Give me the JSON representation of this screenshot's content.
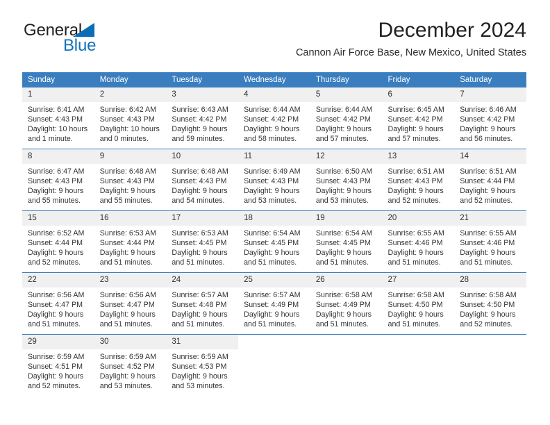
{
  "brand": {
    "name_part1": "General",
    "name_part2": "Blue",
    "accent_color": "#1172b8"
  },
  "header": {
    "title": "December 2024",
    "location": "Cannon Air Force Base, New Mexico, United States"
  },
  "theme": {
    "header_row_bg": "#3a7ebf",
    "daynum_bg": "#f0f0f0",
    "grid_line": "#3a7ebf"
  },
  "calendar": {
    "weekday_headers": [
      "Sunday",
      "Monday",
      "Tuesday",
      "Wednesday",
      "Thursday",
      "Friday",
      "Saturday"
    ],
    "weeks": [
      [
        {
          "day": "1",
          "sunrise": "Sunrise: 6:41 AM",
          "sunset": "Sunset: 4:43 PM",
          "daylight1": "Daylight: 10 hours",
          "daylight2": "and 1 minute."
        },
        {
          "day": "2",
          "sunrise": "Sunrise: 6:42 AM",
          "sunset": "Sunset: 4:43 PM",
          "daylight1": "Daylight: 10 hours",
          "daylight2": "and 0 minutes."
        },
        {
          "day": "3",
          "sunrise": "Sunrise: 6:43 AM",
          "sunset": "Sunset: 4:42 PM",
          "daylight1": "Daylight: 9 hours",
          "daylight2": "and 59 minutes."
        },
        {
          "day": "4",
          "sunrise": "Sunrise: 6:44 AM",
          "sunset": "Sunset: 4:42 PM",
          "daylight1": "Daylight: 9 hours",
          "daylight2": "and 58 minutes."
        },
        {
          "day": "5",
          "sunrise": "Sunrise: 6:44 AM",
          "sunset": "Sunset: 4:42 PM",
          "daylight1": "Daylight: 9 hours",
          "daylight2": "and 57 minutes."
        },
        {
          "day": "6",
          "sunrise": "Sunrise: 6:45 AM",
          "sunset": "Sunset: 4:42 PM",
          "daylight1": "Daylight: 9 hours",
          "daylight2": "and 57 minutes."
        },
        {
          "day": "7",
          "sunrise": "Sunrise: 6:46 AM",
          "sunset": "Sunset: 4:42 PM",
          "daylight1": "Daylight: 9 hours",
          "daylight2": "and 56 minutes."
        }
      ],
      [
        {
          "day": "8",
          "sunrise": "Sunrise: 6:47 AM",
          "sunset": "Sunset: 4:43 PM",
          "daylight1": "Daylight: 9 hours",
          "daylight2": "and 55 minutes."
        },
        {
          "day": "9",
          "sunrise": "Sunrise: 6:48 AM",
          "sunset": "Sunset: 4:43 PM",
          "daylight1": "Daylight: 9 hours",
          "daylight2": "and 55 minutes."
        },
        {
          "day": "10",
          "sunrise": "Sunrise: 6:48 AM",
          "sunset": "Sunset: 4:43 PM",
          "daylight1": "Daylight: 9 hours",
          "daylight2": "and 54 minutes."
        },
        {
          "day": "11",
          "sunrise": "Sunrise: 6:49 AM",
          "sunset": "Sunset: 4:43 PM",
          "daylight1": "Daylight: 9 hours",
          "daylight2": "and 53 minutes."
        },
        {
          "day": "12",
          "sunrise": "Sunrise: 6:50 AM",
          "sunset": "Sunset: 4:43 PM",
          "daylight1": "Daylight: 9 hours",
          "daylight2": "and 53 minutes."
        },
        {
          "day": "13",
          "sunrise": "Sunrise: 6:51 AM",
          "sunset": "Sunset: 4:43 PM",
          "daylight1": "Daylight: 9 hours",
          "daylight2": "and 52 minutes."
        },
        {
          "day": "14",
          "sunrise": "Sunrise: 6:51 AM",
          "sunset": "Sunset: 4:44 PM",
          "daylight1": "Daylight: 9 hours",
          "daylight2": "and 52 minutes."
        }
      ],
      [
        {
          "day": "15",
          "sunrise": "Sunrise: 6:52 AM",
          "sunset": "Sunset: 4:44 PM",
          "daylight1": "Daylight: 9 hours",
          "daylight2": "and 52 minutes."
        },
        {
          "day": "16",
          "sunrise": "Sunrise: 6:53 AM",
          "sunset": "Sunset: 4:44 PM",
          "daylight1": "Daylight: 9 hours",
          "daylight2": "and 51 minutes."
        },
        {
          "day": "17",
          "sunrise": "Sunrise: 6:53 AM",
          "sunset": "Sunset: 4:45 PM",
          "daylight1": "Daylight: 9 hours",
          "daylight2": "and 51 minutes."
        },
        {
          "day": "18",
          "sunrise": "Sunrise: 6:54 AM",
          "sunset": "Sunset: 4:45 PM",
          "daylight1": "Daylight: 9 hours",
          "daylight2": "and 51 minutes."
        },
        {
          "day": "19",
          "sunrise": "Sunrise: 6:54 AM",
          "sunset": "Sunset: 4:45 PM",
          "daylight1": "Daylight: 9 hours",
          "daylight2": "and 51 minutes."
        },
        {
          "day": "20",
          "sunrise": "Sunrise: 6:55 AM",
          "sunset": "Sunset: 4:46 PM",
          "daylight1": "Daylight: 9 hours",
          "daylight2": "and 51 minutes."
        },
        {
          "day": "21",
          "sunrise": "Sunrise: 6:55 AM",
          "sunset": "Sunset: 4:46 PM",
          "daylight1": "Daylight: 9 hours",
          "daylight2": "and 51 minutes."
        }
      ],
      [
        {
          "day": "22",
          "sunrise": "Sunrise: 6:56 AM",
          "sunset": "Sunset: 4:47 PM",
          "daylight1": "Daylight: 9 hours",
          "daylight2": "and 51 minutes."
        },
        {
          "day": "23",
          "sunrise": "Sunrise: 6:56 AM",
          "sunset": "Sunset: 4:47 PM",
          "daylight1": "Daylight: 9 hours",
          "daylight2": "and 51 minutes."
        },
        {
          "day": "24",
          "sunrise": "Sunrise: 6:57 AM",
          "sunset": "Sunset: 4:48 PM",
          "daylight1": "Daylight: 9 hours",
          "daylight2": "and 51 minutes."
        },
        {
          "day": "25",
          "sunrise": "Sunrise: 6:57 AM",
          "sunset": "Sunset: 4:49 PM",
          "daylight1": "Daylight: 9 hours",
          "daylight2": "and 51 minutes."
        },
        {
          "day": "26",
          "sunrise": "Sunrise: 6:58 AM",
          "sunset": "Sunset: 4:49 PM",
          "daylight1": "Daylight: 9 hours",
          "daylight2": "and 51 minutes."
        },
        {
          "day": "27",
          "sunrise": "Sunrise: 6:58 AM",
          "sunset": "Sunset: 4:50 PM",
          "daylight1": "Daylight: 9 hours",
          "daylight2": "and 51 minutes."
        },
        {
          "day": "28",
          "sunrise": "Sunrise: 6:58 AM",
          "sunset": "Sunset: 4:50 PM",
          "daylight1": "Daylight: 9 hours",
          "daylight2": "and 52 minutes."
        }
      ],
      [
        {
          "day": "29",
          "sunrise": "Sunrise: 6:59 AM",
          "sunset": "Sunset: 4:51 PM",
          "daylight1": "Daylight: 9 hours",
          "daylight2": "and 52 minutes."
        },
        {
          "day": "30",
          "sunrise": "Sunrise: 6:59 AM",
          "sunset": "Sunset: 4:52 PM",
          "daylight1": "Daylight: 9 hours",
          "daylight2": "and 53 minutes."
        },
        {
          "day": "31",
          "sunrise": "Sunrise: 6:59 AM",
          "sunset": "Sunset: 4:53 PM",
          "daylight1": "Daylight: 9 hours",
          "daylight2": "and 53 minutes."
        },
        {
          "day": "",
          "sunrise": "",
          "sunset": "",
          "daylight1": "",
          "daylight2": ""
        },
        {
          "day": "",
          "sunrise": "",
          "sunset": "",
          "daylight1": "",
          "daylight2": ""
        },
        {
          "day": "",
          "sunrise": "",
          "sunset": "",
          "daylight1": "",
          "daylight2": ""
        },
        {
          "day": "",
          "sunrise": "",
          "sunset": "",
          "daylight1": "",
          "daylight2": ""
        }
      ]
    ]
  }
}
